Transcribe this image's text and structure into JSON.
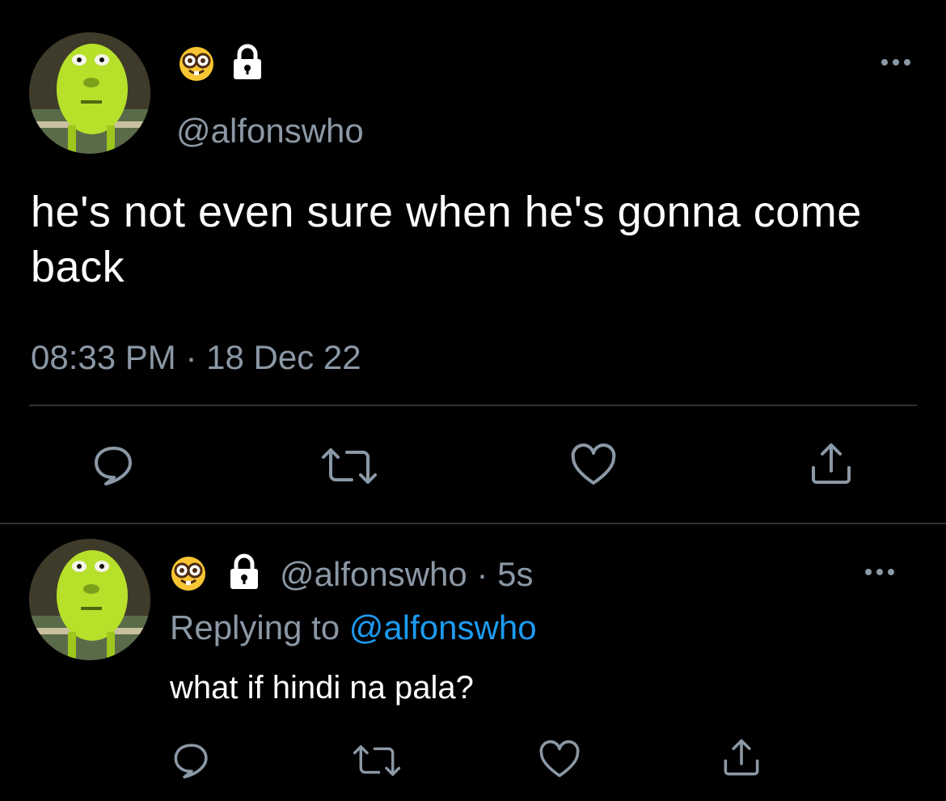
{
  "main_tweet": {
    "handle": "@alfonswho",
    "text": "he's not even sure when he's gonna come back",
    "timestamp": "08:33 PM · 18 Dec 22",
    "name_icons": [
      "nerd-face-emoji",
      "lock-icon"
    ],
    "more_icon": "more-icon"
  },
  "reply_tweet": {
    "handle": "@alfonswho",
    "separator": "·",
    "time": "5s",
    "replying_prefix": "Replying to",
    "replying_handle": "@alfonswho",
    "text": "what if hindi na pala?",
    "name_icons": [
      "nerd-face-emoji",
      "lock-icon"
    ],
    "more_icon": "more-icon"
  },
  "actions": [
    "reply-icon",
    "retweet-icon",
    "like-icon",
    "share-icon"
  ],
  "colors": {
    "background": "#000000",
    "muted": "#8b98a5",
    "link": "#1d9bf0",
    "divider": "#2f3336"
  }
}
